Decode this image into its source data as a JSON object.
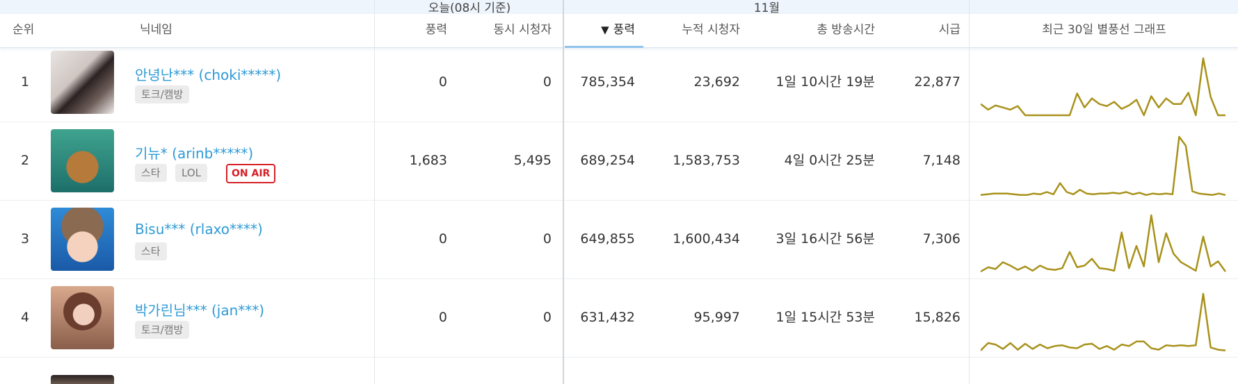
{
  "column_groups": {
    "today": "오늘(08시 기준)",
    "month": "11월"
  },
  "headers": {
    "rank": "순위",
    "nickname": "닉네임",
    "today_balloons": "풍력",
    "today_viewers": "동시 시청자",
    "sort_arrow": "▼",
    "month_balloons": "풍력",
    "month_viewers": "누적 시청자",
    "total_time": "총 방송시간",
    "hourly": "시급",
    "graph": "최근 30일 별풍선 그래프"
  },
  "colors": {
    "nickname": "#2e9ad6",
    "sparkline": "#a8911a",
    "on_air": "#d61f26",
    "header_band": "#eef5fc"
  },
  "rows": [
    {
      "rank": "1",
      "nickname": "안녕난*** (choki*****)",
      "tags": [
        "토크/캠방"
      ],
      "on_air": "",
      "today_balloons": "0",
      "today_viewers": "0",
      "month_balloons": "785,354",
      "month_viewers": "23,692",
      "total_time": "1일 10시간 19분",
      "hourly": "22,877",
      "trend": [
        20,
        12,
        18,
        15,
        12,
        17,
        4,
        4,
        4,
        4,
        4,
        4,
        4,
        35,
        15,
        28,
        20,
        17,
        23,
        13,
        18,
        26,
        4,
        31,
        15,
        28,
        20,
        20,
        36,
        4,
        85,
        30,
        4,
        4
      ]
    },
    {
      "rank": "2",
      "nickname": "기뉴* (arinb*****)",
      "tags": [
        "스타",
        "LOL"
      ],
      "on_air": "ON AIR",
      "today_balloons": "1,683",
      "today_viewers": "5,495",
      "month_balloons": "689,254",
      "month_viewers": "1,583,753",
      "total_time": "4일 0시간 25분",
      "hourly": "7,148",
      "trend": [
        2,
        3,
        4,
        4,
        4,
        3,
        2,
        2,
        4,
        3,
        6,
        3,
        18,
        6,
        3,
        9,
        4,
        3,
        4,
        4,
        5,
        4,
        6,
        3,
        5,
        2,
        4,
        3,
        4,
        3,
        80,
        68,
        7,
        4,
        3,
        2,
        4,
        2
      ]
    },
    {
      "rank": "3",
      "nickname": "Bisu*** (rlaxo****)",
      "tags": [
        "스타"
      ],
      "on_air": "",
      "today_balloons": "0",
      "today_viewers": "0",
      "month_balloons": "649,855",
      "month_viewers": "1,600,434",
      "total_time": "3일 16시간 56분",
      "hourly": "7,306",
      "trend": [
        4,
        9,
        7,
        15,
        11,
        6,
        10,
        5,
        11,
        7,
        6,
        8,
        27,
        9,
        11,
        19,
        8,
        7,
        5,
        50,
        8,
        34,
        10,
        70,
        15,
        49,
        25,
        15,
        10,
        5,
        45,
        10,
        16,
        4
      ]
    },
    {
      "rank": "4",
      "nickname": "박가린님*** (jan***)",
      "tags": [
        "토크/캠방"
      ],
      "on_air": "",
      "today_balloons": "0",
      "today_viewers": "0",
      "month_balloons": "631,432",
      "month_viewers": "95,997",
      "total_time": "1일 15시간 53분",
      "hourly": "15,826",
      "trend": [
        4,
        14,
        12,
        6,
        14,
        5,
        13,
        6,
        12,
        7,
        10,
        11,
        8,
        7,
        12,
        13,
        6,
        10,
        5,
        12,
        10,
        16,
        16,
        7,
        5,
        11,
        10,
        11,
        10,
        11,
        80,
        8,
        5,
        4
      ]
    }
  ]
}
